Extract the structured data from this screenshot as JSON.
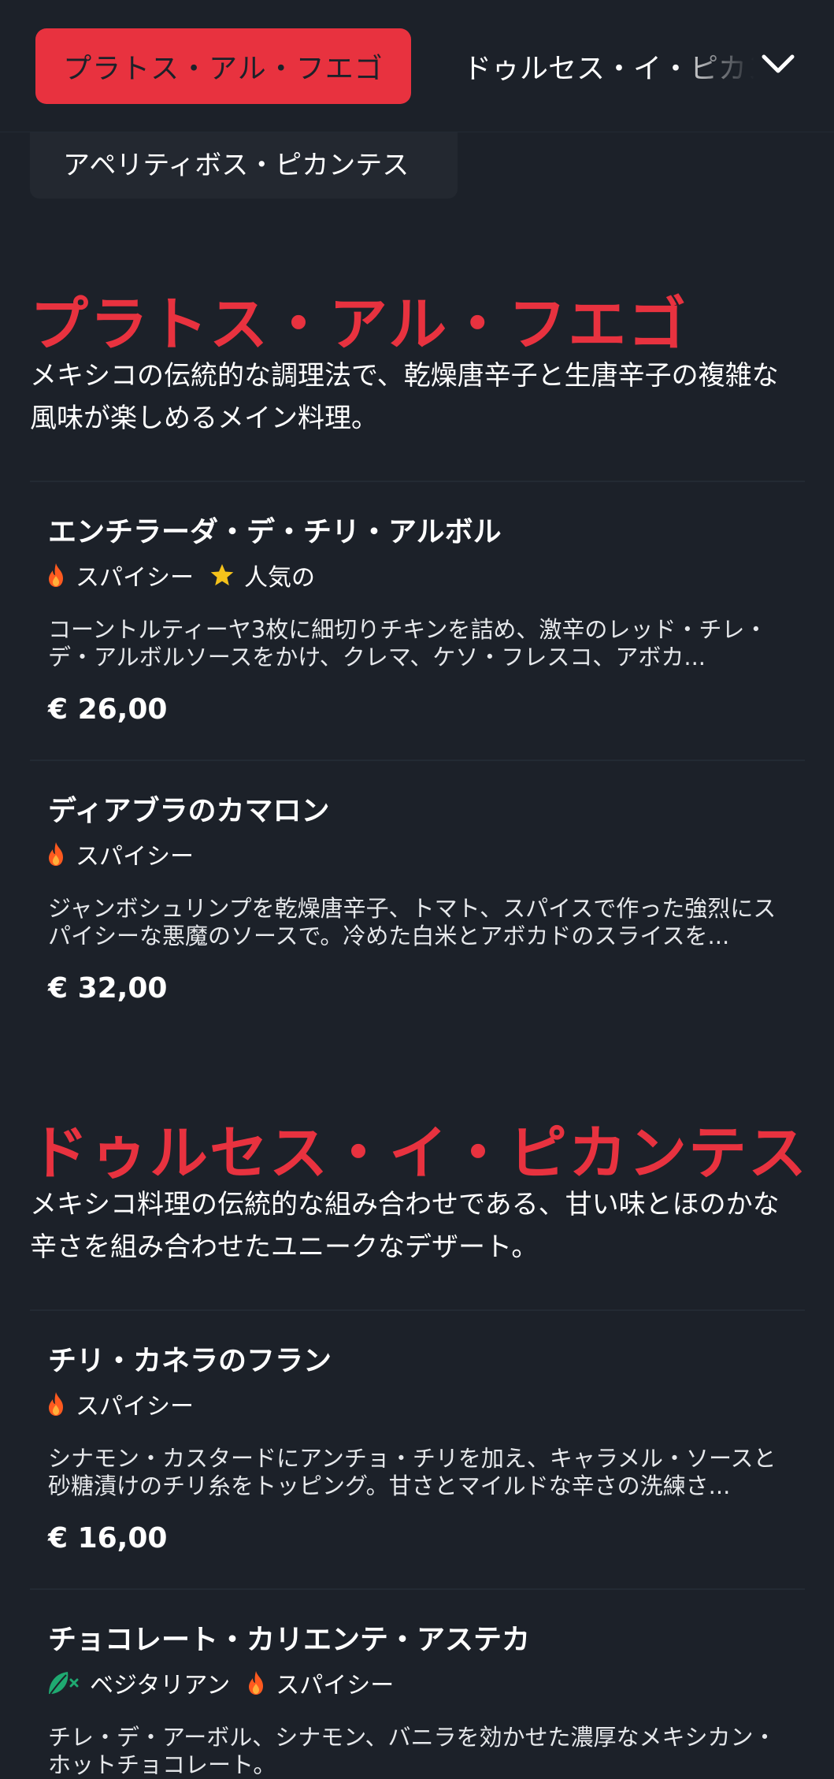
{
  "nav": {
    "active_tab": "プラトス・アル・フエゴ",
    "next_tab": "ドゥルセス・イ・ピカンテス",
    "prev_chip": "アペリティボス・ピカンテス"
  },
  "sections": [
    {
      "title": "プラトス・アル・フエゴ",
      "description": "メキシコの伝統的な調理法で、乾燥唐辛子と生唐辛子の複雑な風味が楽しめるメイン料理。",
      "items": [
        {
          "name": "エンチラーダ・デ・チリ・アルボル",
          "tags": [
            "スパイシー",
            "人気の"
          ],
          "description": "コーントルティーヤ3枚に細切りチキンを詰め、激辛のレッド・チレ・デ・アルボルソースをかけ、クレマ、ケソ・フレスコ、アボカ...",
          "price": "€ 26,00"
        },
        {
          "name": "ディアブラのカマロン",
          "tags": [
            "スパイシー"
          ],
          "description": "ジャンボシュリンプを乾燥唐辛子、トマト、スパイスで作った強烈にスパイシーな悪魔のソースで。冷めた白米とアボカドのスライスを...",
          "price": "€ 32,00"
        }
      ]
    },
    {
      "title": "ドゥルセス・イ・ピカンテス",
      "description": "メキシコ料理の伝統的な組み合わせである、甘い味とほのかな辛さを組み合わせたユニークなデザート。",
      "items": [
        {
          "name": "チリ・カネラのフラン",
          "tags": [
            "スパイシー"
          ],
          "description": "シナモン・カスタードにアンチョ・チリを加え、キャラメル・ソースと砂糖漬けのチリ糸をトッピング。甘さとマイルドな辛さの洗練さ...",
          "price": "€ 16,00"
        },
        {
          "name": "チョコレート・カリエンテ・アステカ",
          "tags": [
            "ベジタリアン",
            "スパイシー"
          ],
          "description": "チレ・デ・アーボル、シナモン、バニラを効かせた濃厚なメキシカン・ホットチョコレート。",
          "price": ""
        }
      ]
    }
  ],
  "colors": {
    "accent": "#e8323f",
    "background": "#1c2129",
    "spicy_icon": "#ff5a1f",
    "star_icon": "#f4c21b",
    "vegetarian_icon": "#1fa971"
  },
  "icons": {
    "spicy": "flame-icon",
    "popular": "star-icon",
    "vegetarian": "leaf-icon",
    "dropdown": "chevron-down-icon"
  }
}
